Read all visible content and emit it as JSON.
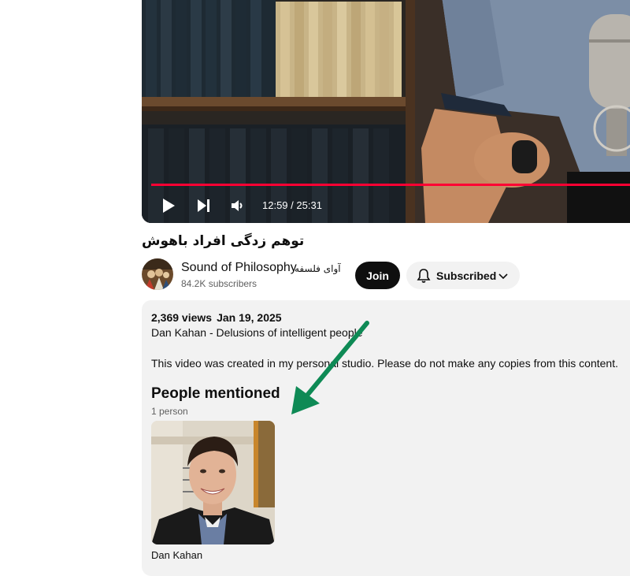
{
  "player": {
    "current_time": "12:59",
    "duration": "25:31",
    "progress_fraction": 0.99,
    "accent_color": "#ff0033"
  },
  "video": {
    "title": "توهم زدگی افراد باهوش"
  },
  "channel": {
    "name": "Sound of Philosophy",
    "alt_name": "آوای فلسفه",
    "subscribers": "84.2K subscribers",
    "join_label": "Join",
    "subscribed_label": "Subscribed"
  },
  "description": {
    "views": "2,369 views",
    "date": "Jan 19, 2025",
    "line1": "Dan Kahan - Delusions of intelligent people",
    "line2": "This video was created in my personal studio. Please do not make any copies from this content.",
    "people_heading": "People mentioned",
    "people_count": "1 person",
    "person_name": "Dan Kahan"
  },
  "annotation": {
    "arrow_color": "#0e8a55"
  }
}
